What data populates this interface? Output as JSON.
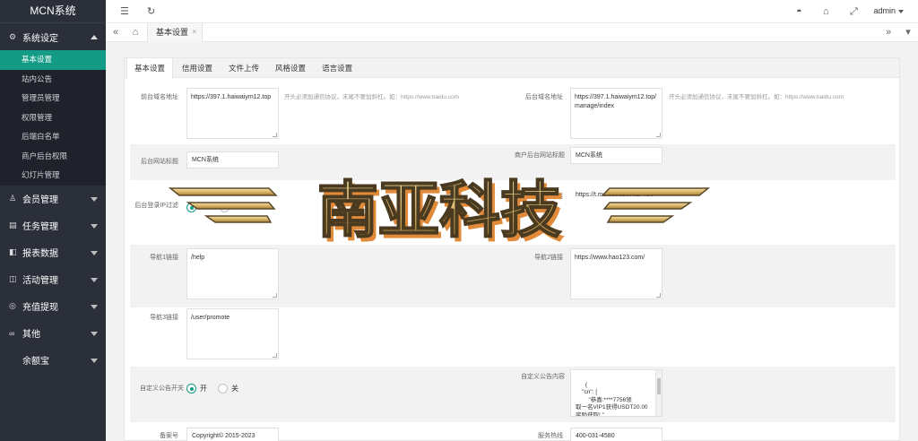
{
  "brand": "MCN系统",
  "sidebar": {
    "groups": [
      {
        "label": "系统设定",
        "icon": "gear-icon",
        "glyph": "⚙",
        "expanded": true,
        "items": [
          {
            "label": "基本设置",
            "active": true
          },
          {
            "label": "站内公告"
          },
          {
            "label": "管理员管理"
          },
          {
            "label": "权限管理"
          },
          {
            "label": "后端白名单"
          },
          {
            "label": "商户后台权限"
          },
          {
            "label": "幻灯片管理"
          }
        ]
      },
      {
        "label": "会员管理",
        "icon": "user-icon",
        "glyph": "♙"
      },
      {
        "label": "任务管理",
        "icon": "task-icon",
        "glyph": "▤"
      },
      {
        "label": "报表数据",
        "icon": "report-icon",
        "glyph": "◧"
      },
      {
        "label": "活动管理",
        "icon": "activity-icon",
        "glyph": "◫"
      },
      {
        "label": "充值提现",
        "icon": "money-icon",
        "glyph": "◎"
      },
      {
        "label": "其他",
        "icon": "more-icon",
        "glyph": "∞"
      },
      {
        "label": "余额宝",
        "icon": "wallet-icon",
        "glyph": ""
      }
    ]
  },
  "header": {
    "user": "admin"
  },
  "tabbar": {
    "current_tab": "基本设置",
    "close": "×"
  },
  "form": {
    "tabs": [
      "基本设置",
      "信用设置",
      "文件上传",
      "风格设置",
      "语言设置"
    ],
    "front_domain": {
      "label": "前台域名地址",
      "value": "https://397.1.haiwaiym12.top",
      "hint": "开头必须加通信协议，末尾不要加斜杠。如：https://www.baidu.com"
    },
    "back_domain": {
      "label": "后台域名地址",
      "value": "https://397.1.haiwaiym12.top/manage/index",
      "hint": "开头必须加通信协议，末尾不要加斜杠。如：https://www.baidu.com"
    },
    "site_title": {
      "label": "后台网站标题",
      "value": "MCN系统"
    },
    "merchant_title": {
      "label": "商户后台网站标题",
      "value": "MCN系统"
    },
    "login_ip": {
      "label": "后台登录IP过滤"
    },
    "service_link": {
      "label": "客服链接",
      "value": "https://t.me/ds88265327406"
    },
    "nav1": {
      "label": "导航1链接",
      "value": "/help"
    },
    "nav2": {
      "label": "导航2链接",
      "value": "https://www.hao123.com/"
    },
    "nav3": {
      "label": "导航3链接",
      "value": "/user/promote"
    },
    "notice_switch": {
      "label": "自定义公告开关",
      "on": "开",
      "off": "关"
    },
    "notice_content": {
      "label": "自定义公告内容",
      "value": "{\n    \"cn\": [\n        \"恭喜:****7756领\n取一名VIP1获得USDT20.00\n奖励获取! \""
    },
    "record_no": {
      "label": "备案号",
      "value": "Copyright© 2015-2023"
    },
    "service_hotline": {
      "label": "服务热线",
      "value": "400-031-4580"
    }
  },
  "watermark": {
    "text": "南亚科技"
  },
  "colors": {
    "accent": "#139b86",
    "sidebar_bg": "#2b2f3a",
    "sidebar_sub_bg": "#1f222b"
  }
}
